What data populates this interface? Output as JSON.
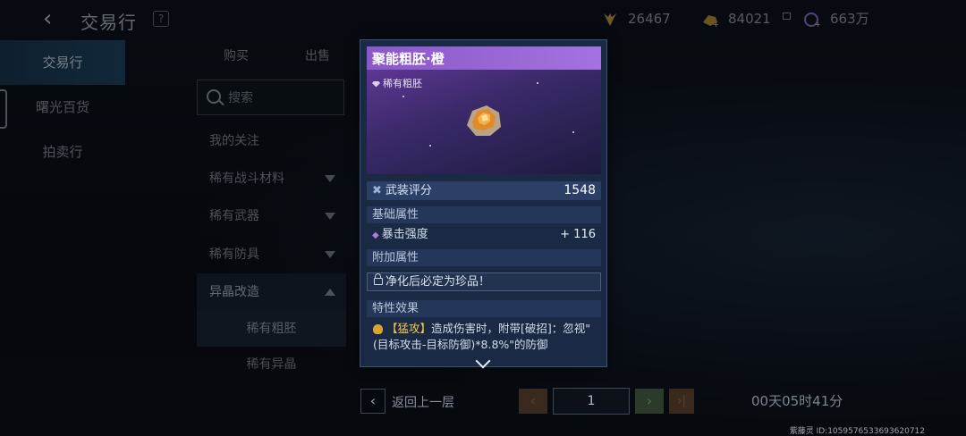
{
  "header": {
    "title": "交易行",
    "help": "?",
    "currencies": [
      {
        "icon": "badge-currency-icon",
        "value": "26467"
      },
      {
        "icon": "gold-plus-currency-icon",
        "value": "84021"
      },
      {
        "icon": "gem-currency-icon",
        "value": "663万"
      }
    ]
  },
  "sidebar": {
    "items": [
      {
        "label": "交易行"
      },
      {
        "label": "曙光百货"
      },
      {
        "label": "拍卖行"
      }
    ]
  },
  "tabs": [
    {
      "label": "购买"
    },
    {
      "label": "出售"
    }
  ],
  "search": {
    "placeholder": "搜索"
  },
  "categories": [
    {
      "label": "我的关注"
    },
    {
      "label": "稀有战斗材料"
    },
    {
      "label": "稀有武器"
    },
    {
      "label": "稀有防具"
    },
    {
      "label": "异晶改造"
    }
  ],
  "subcategories": [
    {
      "label": "稀有粗胚"
    },
    {
      "label": "稀有异晶"
    }
  ],
  "bottom": {
    "prev_label": "返回上一层",
    "page": "1",
    "timer": "00天05时41分",
    "uid": "紫藤灵 ID:1059576533693620712"
  },
  "popup": {
    "title": "聚能粗胚·橙",
    "rarity": "稀有粗胚",
    "score_label": "武装评分",
    "score_value": "1548",
    "base_section": "基础属性",
    "stat_label": "暴击强度",
    "stat_value": "+ 116",
    "extra_section": "附加属性",
    "lock_text": "净化后必定为珍品！",
    "trait_section": "特性效果",
    "trait_tag": "【猛攻】",
    "trait_text": "造成伤害时，附带[破招]：忽视\"(目标攻击-目标防御)*8.8%\"的防御"
  },
  "colors": {
    "accent_purple": "#a273de",
    "panel": "#1b2a44",
    "sidebar_active": "#204a6a"
  }
}
